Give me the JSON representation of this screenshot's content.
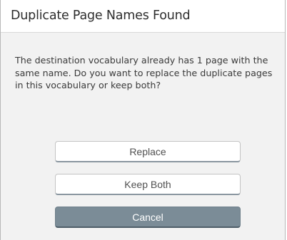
{
  "dialog": {
    "title": "Duplicate Page Names Found",
    "message": "The destination vocabulary already has 1 page with the same name. Do you want to replace the duplicate pages in this vocabulary or keep both?",
    "buttons": {
      "replace": "Replace",
      "keep_both": "Keep Both",
      "cancel": "Cancel"
    }
  },
  "colors": {
    "background": "#f2f2f2",
    "header_background": "#ffffff",
    "cancel_button": "#7b8c97",
    "button_text_light": "#505050"
  }
}
